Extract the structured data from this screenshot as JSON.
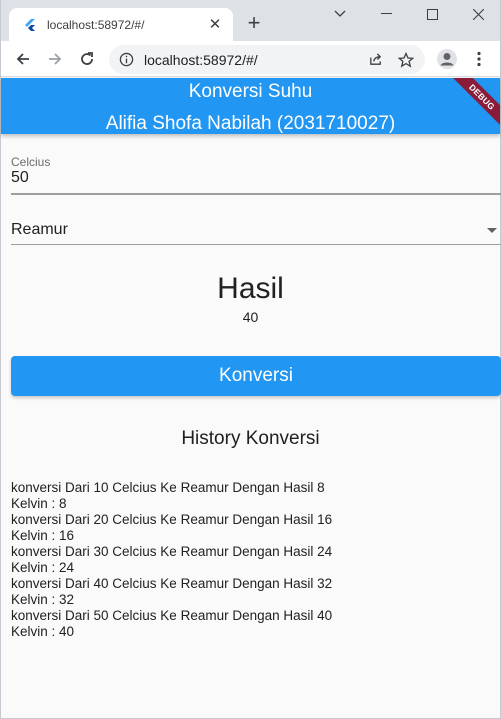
{
  "browser": {
    "tab_title": "localhost:58972/#/",
    "tab_close": "✕",
    "new_tab": "+",
    "url": "localhost:58972/#/"
  },
  "app": {
    "title_line1": "Konversi Suhu",
    "title_line2": "Alifia Shofa Nabilah (2031710027)",
    "debug_banner": "DEBUG",
    "primary_color": "#2196f3",
    "input": {
      "label": "Celcius",
      "value": "50"
    },
    "dropdown": {
      "selected": "Reamur"
    },
    "result": {
      "heading": "Hasil",
      "value": "40"
    },
    "convert_button": "Konversi",
    "history": {
      "title": "History Konversi",
      "items": [
        {
          "line1": "konversi Dari 10 Celcius Ke Reamur Dengan Hasil 8",
          "line2": "Kelvin : 8"
        },
        {
          "line1": "konversi Dari 20 Celcius Ke Reamur Dengan Hasil 16",
          "line2": "Kelvin : 16"
        },
        {
          "line1": "konversi Dari 30 Celcius Ke Reamur Dengan Hasil 24",
          "line2": "Kelvin : 24"
        },
        {
          "line1": "konversi Dari 40 Celcius Ke Reamur Dengan Hasil 32",
          "line2": "Kelvin : 32"
        },
        {
          "line1": "konversi Dari 50 Celcius Ke Reamur Dengan Hasil 40",
          "line2": "Kelvin : 40"
        }
      ]
    }
  }
}
